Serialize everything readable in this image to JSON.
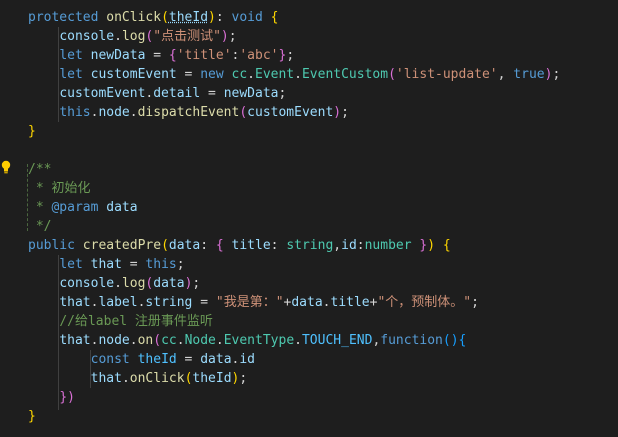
{
  "editor": {
    "lines": [
      [
        [
          "protected",
          "#569cd6"
        ],
        [
          " ",
          "#d4d4d4"
        ],
        [
          "onClick",
          "#dcdcaa"
        ],
        [
          "(",
          "#ffd700"
        ],
        [
          "theId",
          "#9cdcfe",
          "sq"
        ],
        [
          ")",
          "#ffd700"
        ],
        [
          ": ",
          "#d4d4d4"
        ],
        [
          "void",
          "#569cd6"
        ],
        [
          " ",
          "#d4d4d4"
        ],
        [
          "{",
          "#ffd700"
        ]
      ],
      [
        [
          "    ",
          "#d4d4d4"
        ],
        [
          "console",
          "#9cdcfe"
        ],
        [
          ".",
          "#d4d4d4"
        ],
        [
          "log",
          "#dcdcaa"
        ],
        [
          "(",
          "#da70d6"
        ],
        [
          "\"点击测试\"",
          "#ce9178"
        ],
        [
          ")",
          "#da70d6"
        ],
        [
          ";",
          "#d4d4d4"
        ]
      ],
      [
        [
          "    ",
          "#d4d4d4"
        ],
        [
          "let",
          "#569cd6"
        ],
        [
          " ",
          "#d4d4d4"
        ],
        [
          "newData",
          "#9cdcfe"
        ],
        [
          " = ",
          "#d4d4d4"
        ],
        [
          "{",
          "#da70d6"
        ],
        [
          "'title'",
          "#ce9178"
        ],
        [
          ":",
          "#d4d4d4"
        ],
        [
          "'abc'",
          "#ce9178"
        ],
        [
          "}",
          "#da70d6"
        ],
        [
          ";",
          "#d4d4d4"
        ]
      ],
      [
        [
          "    ",
          "#d4d4d4"
        ],
        [
          "let",
          "#569cd6"
        ],
        [
          " ",
          "#d4d4d4"
        ],
        [
          "customEvent",
          "#9cdcfe"
        ],
        [
          " = ",
          "#d4d4d4"
        ],
        [
          "new",
          "#569cd6"
        ],
        [
          " ",
          "#d4d4d4"
        ],
        [
          "cc",
          "#4ec9b0"
        ],
        [
          ".",
          "#d4d4d4"
        ],
        [
          "Event",
          "#4ec9b0"
        ],
        [
          ".",
          "#d4d4d4"
        ],
        [
          "EventCustom",
          "#4ec9b0"
        ],
        [
          "(",
          "#da70d6"
        ],
        [
          "'list-update'",
          "#ce9178"
        ],
        [
          ", ",
          "#d4d4d4"
        ],
        [
          "true",
          "#569cd6"
        ],
        [
          ")",
          "#da70d6"
        ],
        [
          ";",
          "#d4d4d4"
        ]
      ],
      [
        [
          "    ",
          "#d4d4d4"
        ],
        [
          "customEvent",
          "#9cdcfe"
        ],
        [
          ".",
          "#d4d4d4"
        ],
        [
          "detail",
          "#9cdcfe"
        ],
        [
          " = ",
          "#d4d4d4"
        ],
        [
          "newData",
          "#9cdcfe"
        ],
        [
          ";",
          "#d4d4d4"
        ]
      ],
      [
        [
          "    ",
          "#d4d4d4"
        ],
        [
          "this",
          "#569cd6"
        ],
        [
          ".",
          "#d4d4d4"
        ],
        [
          "node",
          "#9cdcfe"
        ],
        [
          ".",
          "#d4d4d4"
        ],
        [
          "dispatchEvent",
          "#dcdcaa"
        ],
        [
          "(",
          "#da70d6"
        ],
        [
          "customEvent",
          "#9cdcfe"
        ],
        [
          ")",
          "#da70d6"
        ],
        [
          ";",
          "#d4d4d4"
        ]
      ],
      [
        [
          "}",
          "#ffd700"
        ]
      ],
      [],
      [
        [
          "/**",
          "#6a9955"
        ]
      ],
      [
        [
          " * 初始化",
          "#6a9955"
        ]
      ],
      [
        [
          " * ",
          "#6a9955"
        ],
        [
          "@param",
          "#569cd6"
        ],
        [
          " ",
          "#6a9955"
        ],
        [
          "data",
          "#9cdcfe"
        ]
      ],
      [
        [
          " */",
          "#6a9955"
        ]
      ],
      [
        [
          "public",
          "#569cd6"
        ],
        [
          " ",
          "#d4d4d4"
        ],
        [
          "createdPre",
          "#dcdcaa"
        ],
        [
          "(",
          "#ffd700"
        ],
        [
          "data",
          "#9cdcfe"
        ],
        [
          ": ",
          "#d4d4d4"
        ],
        [
          "{",
          "#da70d6"
        ],
        [
          " ",
          "#d4d4d4"
        ],
        [
          "title",
          "#9cdcfe"
        ],
        [
          ": ",
          "#d4d4d4"
        ],
        [
          "string",
          "#4ec9b0"
        ],
        [
          ",",
          "#d4d4d4"
        ],
        [
          "id",
          "#9cdcfe"
        ],
        [
          ":",
          "#d4d4d4"
        ],
        [
          "number",
          "#4ec9b0"
        ],
        [
          " ",
          "#d4d4d4"
        ],
        [
          "}",
          "#da70d6"
        ],
        [
          ")",
          "#ffd700"
        ],
        [
          " ",
          "#d4d4d4"
        ],
        [
          "{",
          "#ffd700"
        ]
      ],
      [
        [
          "    ",
          "#d4d4d4"
        ],
        [
          "let",
          "#569cd6"
        ],
        [
          " ",
          "#d4d4d4"
        ],
        [
          "that",
          "#9cdcfe"
        ],
        [
          " = ",
          "#d4d4d4"
        ],
        [
          "this",
          "#569cd6"
        ],
        [
          ";",
          "#d4d4d4"
        ]
      ],
      [
        [
          "    ",
          "#d4d4d4"
        ],
        [
          "console",
          "#9cdcfe"
        ],
        [
          ".",
          "#d4d4d4"
        ],
        [
          "log",
          "#dcdcaa"
        ],
        [
          "(",
          "#da70d6"
        ],
        [
          "data",
          "#9cdcfe"
        ],
        [
          ")",
          "#da70d6"
        ],
        [
          ";",
          "#d4d4d4"
        ]
      ],
      [
        [
          "    ",
          "#d4d4d4"
        ],
        [
          "that",
          "#9cdcfe"
        ],
        [
          ".",
          "#d4d4d4"
        ],
        [
          "label",
          "#9cdcfe"
        ],
        [
          ".",
          "#d4d4d4"
        ],
        [
          "string",
          "#9cdcfe"
        ],
        [
          " = ",
          "#d4d4d4"
        ],
        [
          "\"我是第：\"",
          "#ce9178"
        ],
        [
          "+",
          "#d4d4d4"
        ],
        [
          "data",
          "#9cdcfe"
        ],
        [
          ".",
          "#d4d4d4"
        ],
        [
          "title",
          "#9cdcfe"
        ],
        [
          "+",
          "#d4d4d4"
        ],
        [
          "\"个，预制体。\"",
          "#ce9178"
        ],
        [
          ";",
          "#d4d4d4"
        ]
      ],
      [
        [
          "    ",
          "#d4d4d4"
        ],
        [
          "//给label 注册事件监听",
          "#6a9955"
        ]
      ],
      [
        [
          "    ",
          "#d4d4d4"
        ],
        [
          "that",
          "#9cdcfe"
        ],
        [
          ".",
          "#d4d4d4"
        ],
        [
          "node",
          "#9cdcfe"
        ],
        [
          ".",
          "#d4d4d4"
        ],
        [
          "on",
          "#dcdcaa"
        ],
        [
          "(",
          "#da70d6"
        ],
        [
          "cc",
          "#4ec9b0"
        ],
        [
          ".",
          "#d4d4d4"
        ],
        [
          "Node",
          "#4ec9b0"
        ],
        [
          ".",
          "#d4d4d4"
        ],
        [
          "EventType",
          "#4ec9b0"
        ],
        [
          ".",
          "#d4d4d4"
        ],
        [
          "TOUCH_END",
          "#4fc1ff"
        ],
        [
          ",",
          "#d4d4d4"
        ],
        [
          "function",
          "#569cd6"
        ],
        [
          "()",
          "#179fff"
        ],
        [
          "{",
          "#179fff"
        ]
      ],
      [
        [
          "        ",
          "#d4d4d4"
        ],
        [
          "const",
          "#569cd6"
        ],
        [
          " ",
          "#d4d4d4"
        ],
        [
          "theId",
          "#4fc1ff"
        ],
        [
          " = ",
          "#d4d4d4"
        ],
        [
          "data",
          "#9cdcfe"
        ],
        [
          ".",
          "#d4d4d4"
        ],
        [
          "id",
          "#9cdcfe"
        ]
      ],
      [
        [
          "        ",
          "#d4d4d4"
        ],
        [
          "that",
          "#9cdcfe"
        ],
        [
          ".",
          "#d4d4d4"
        ],
        [
          "onClick",
          "#dcdcaa"
        ],
        [
          "(",
          "#ffd700"
        ],
        [
          "theId",
          "#9cdcfe"
        ],
        [
          ")",
          "#ffd700"
        ],
        [
          ";",
          "#d4d4d4"
        ]
      ],
      [
        [
          "    ",
          "#d4d4d4"
        ],
        [
          "})",
          "#da70d6"
        ]
      ],
      [
        [
          "}",
          "#ffd700"
        ]
      ]
    ]
  }
}
